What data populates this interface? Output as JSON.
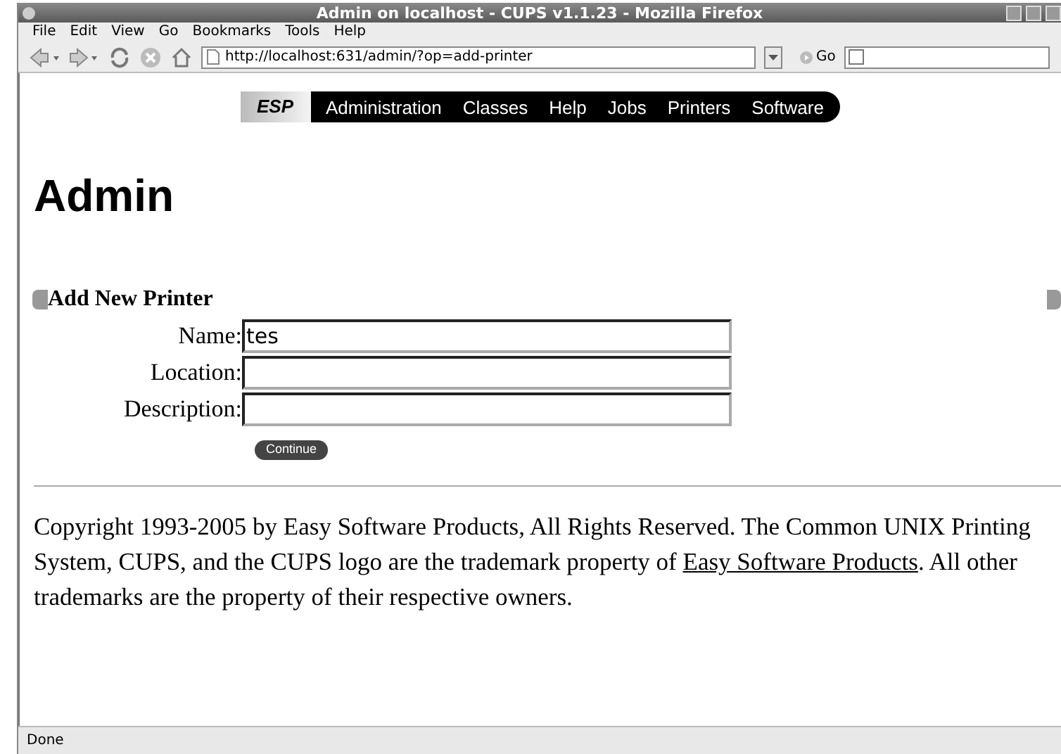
{
  "window": {
    "title": "Admin on localhost - CUPS v1.1.23 - Mozilla Firefox"
  },
  "menu": [
    "File",
    "Edit",
    "View",
    "Go",
    "Bookmarks",
    "Tools",
    "Help"
  ],
  "toolbar": {
    "url": "http://localhost:631/admin/?op=add-printer",
    "go": "Go"
  },
  "nav": {
    "logo": "ESP",
    "items": [
      "Administration",
      "Classes",
      "Help",
      "Jobs",
      "Printers",
      "Software"
    ]
  },
  "heading": "Admin",
  "section": "Add New Printer",
  "form": [
    {
      "label": "Name:",
      "value": "tes"
    },
    {
      "label": "Location:"
    },
    {
      "label": "Description:"
    }
  ],
  "button": "Continue",
  "footer": {
    "before": "Copyright 1993-2005 by Easy Software Products, All Rights Reserved. The Common UNIX Printing System, CUPS, and the CUPS logo are the trademark property of",
    "link": "Easy Software Products",
    "after": ". All other trademarks are the property of their respective owners."
  },
  "status_bar": "Done"
}
